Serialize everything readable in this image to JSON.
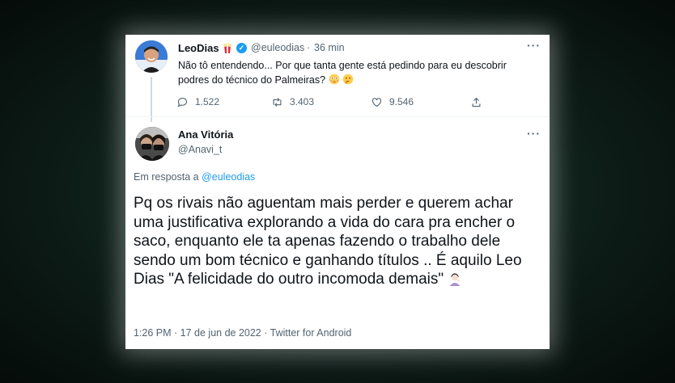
{
  "tweet1": {
    "author_name": "LeoDias",
    "handle": "@euleodias",
    "separator": "·",
    "time": "36 min",
    "text": "Não tô entendendo... Por que tanta gente está pedindo para eu descobrir podres do técnico do Palmeiras?",
    "replies": "1.522",
    "retweets": "3.403",
    "likes": "9.546"
  },
  "tweet2": {
    "author_name": "Ana Vitória",
    "handle": "@Anavi_t",
    "reply_prefix": "Em resposta a",
    "reply_to": "@euleodias",
    "text": "Pq os rivais não aguentam mais perder e querem achar uma justificativa explorando a vida do cara pra encher o saco, enquanto ele ta apenas fazendo o trabalho dele sendo um bom técnico e ganhando títulos .. É aquilo Leo Dias \"A felicidade do outro incomoda demais\"",
    "timestamp": "1:26 PM · 17 de jun de 2022 · Twitter for Android"
  },
  "icons": [
    "popcorn-icon",
    "verified-badge-icon",
    "more-icon",
    "reply-icon",
    "retweet-icon",
    "like-icon",
    "share-icon"
  ],
  "colors": {
    "accent": "#1d9bf0",
    "text": "#0f1419",
    "muted": "#536471",
    "background": "#0f211b"
  }
}
